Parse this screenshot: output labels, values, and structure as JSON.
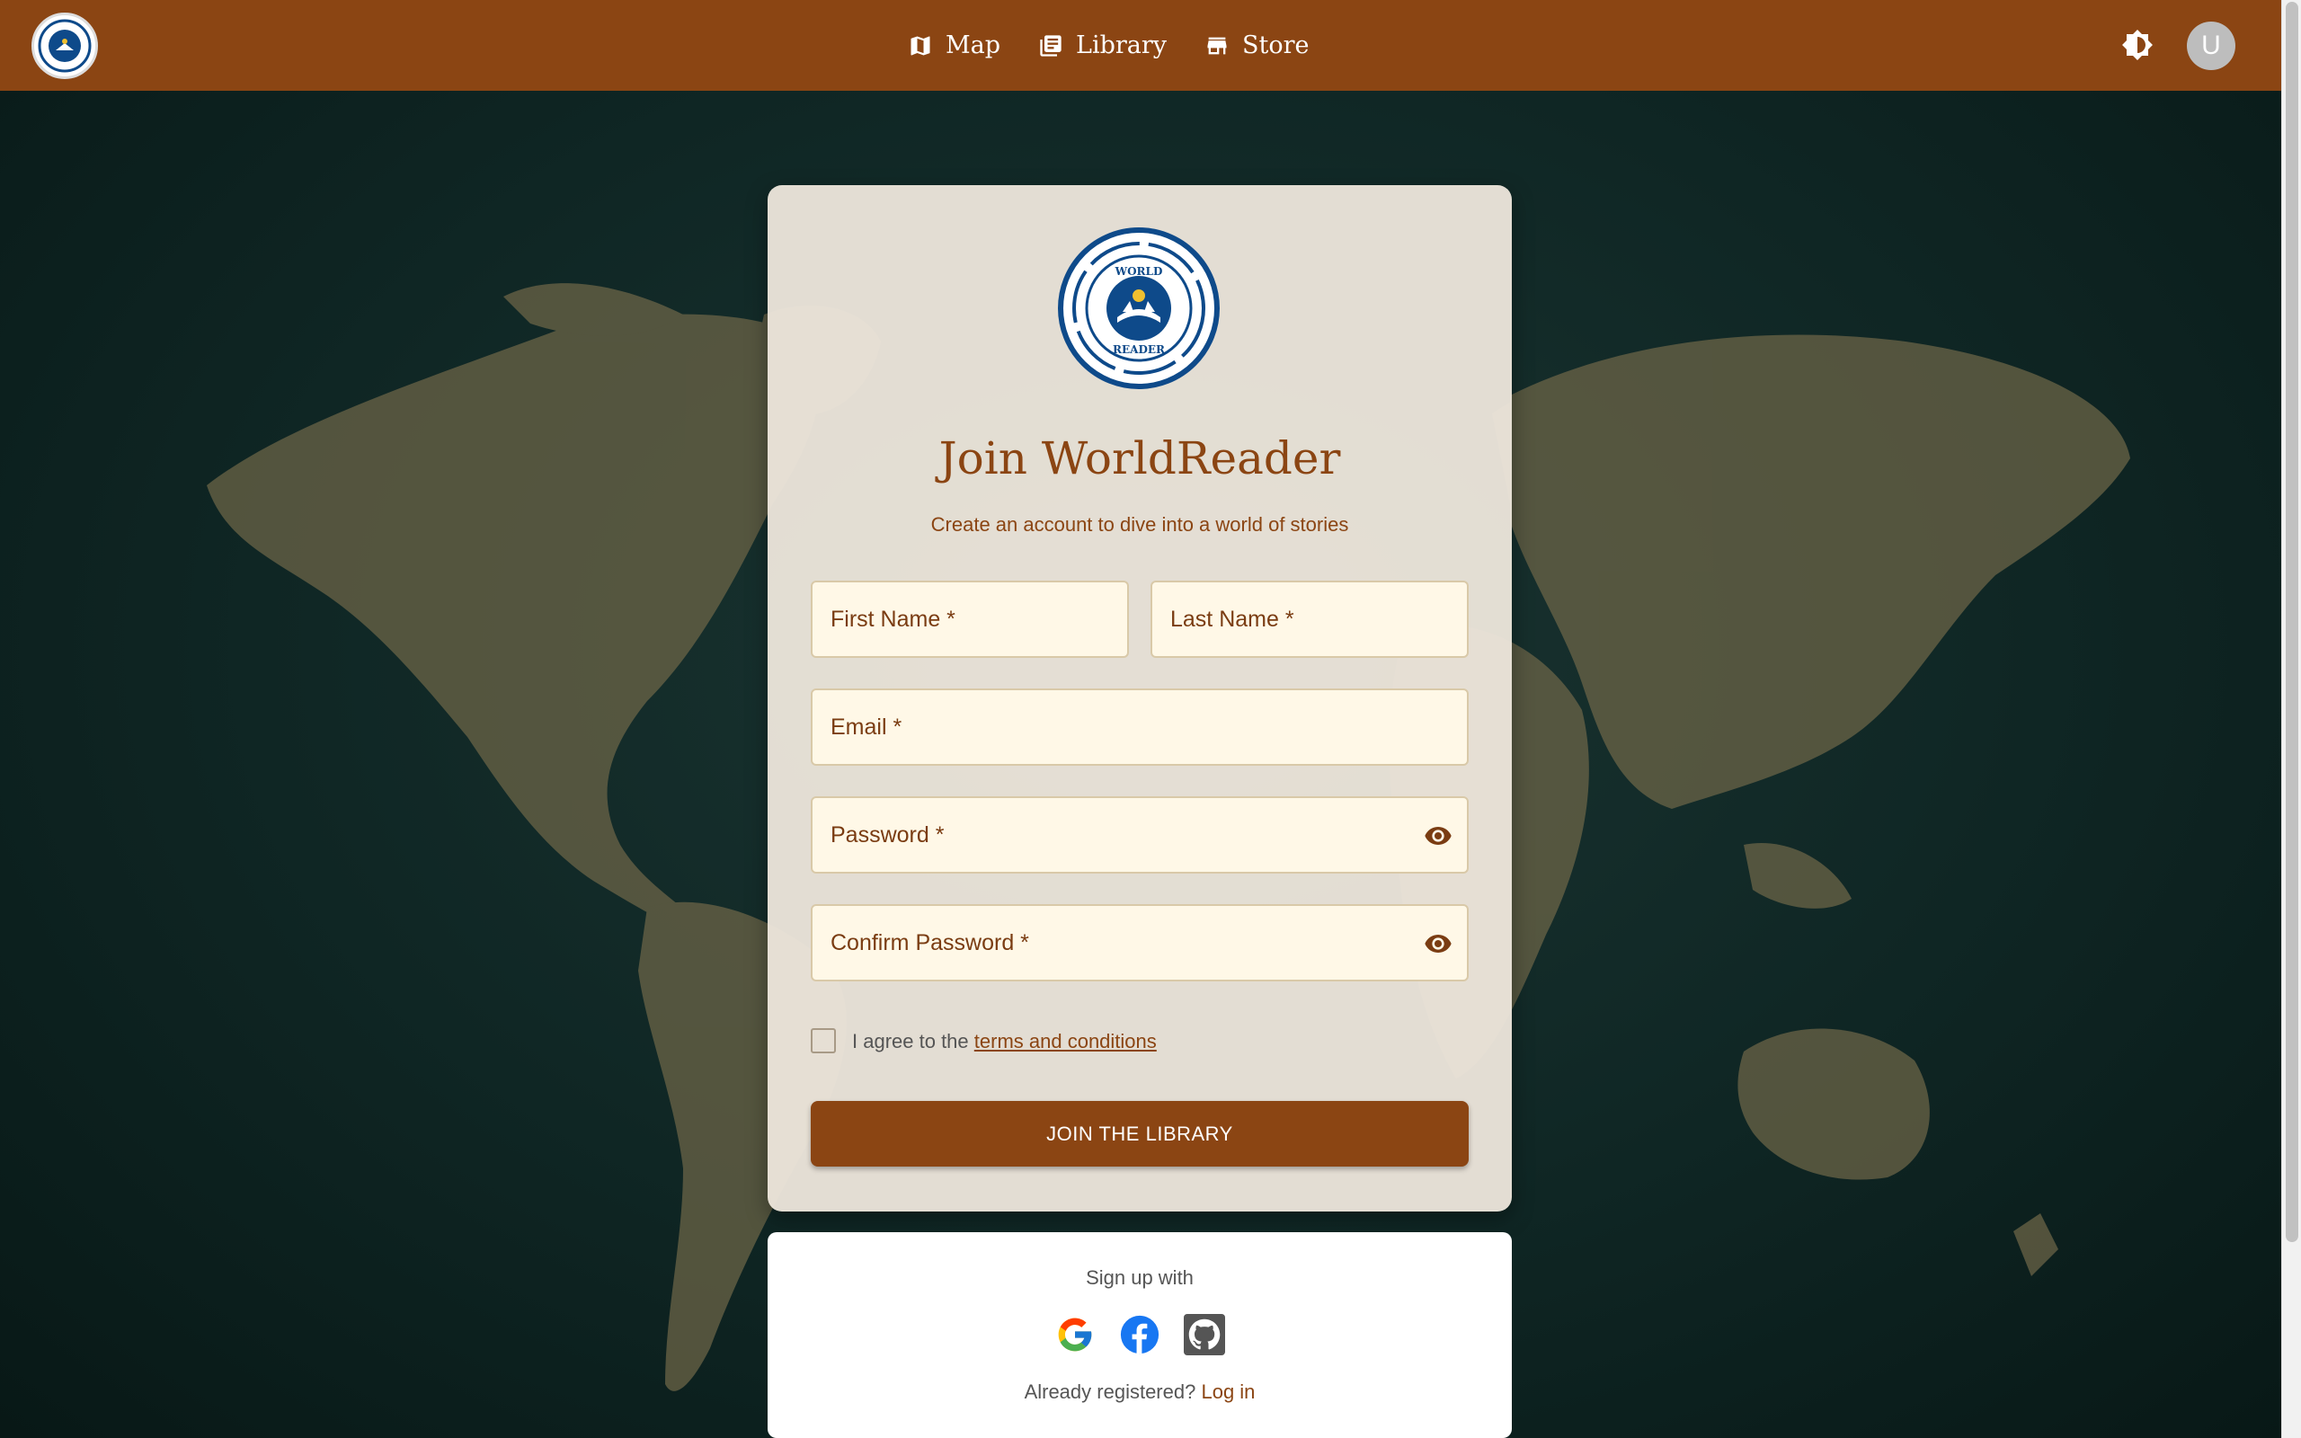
{
  "nav": {
    "items": [
      {
        "label": "Map",
        "icon": "map-icon"
      },
      {
        "label": "Library",
        "icon": "library-icon"
      },
      {
        "label": "Store",
        "icon": "store-icon"
      }
    ],
    "avatar_initial": "U"
  },
  "card": {
    "logo_text_top": "WORLD",
    "logo_text_bottom": "READER",
    "title": "Join WorldReader",
    "subtitle": "Create an account to dive into a world of stories",
    "fields": {
      "first_name": "First Name *",
      "last_name": "Last Name *",
      "email": "Email *",
      "password": "Password *",
      "confirm_password": "Confirm Password *"
    },
    "agree_prefix": "I agree to the",
    "terms_link": "terms and conditions",
    "join_button": "JOIN THE LIBRARY"
  },
  "signup": {
    "label": "Sign up with",
    "providers": [
      "google-icon",
      "facebook-icon",
      "github-icon"
    ],
    "already": "Already registered?",
    "login_link": "Log in"
  },
  "colors": {
    "brand": "#8b4513",
    "logo_blue": "#0e4a8a",
    "field_bg": "#fff8e7"
  }
}
